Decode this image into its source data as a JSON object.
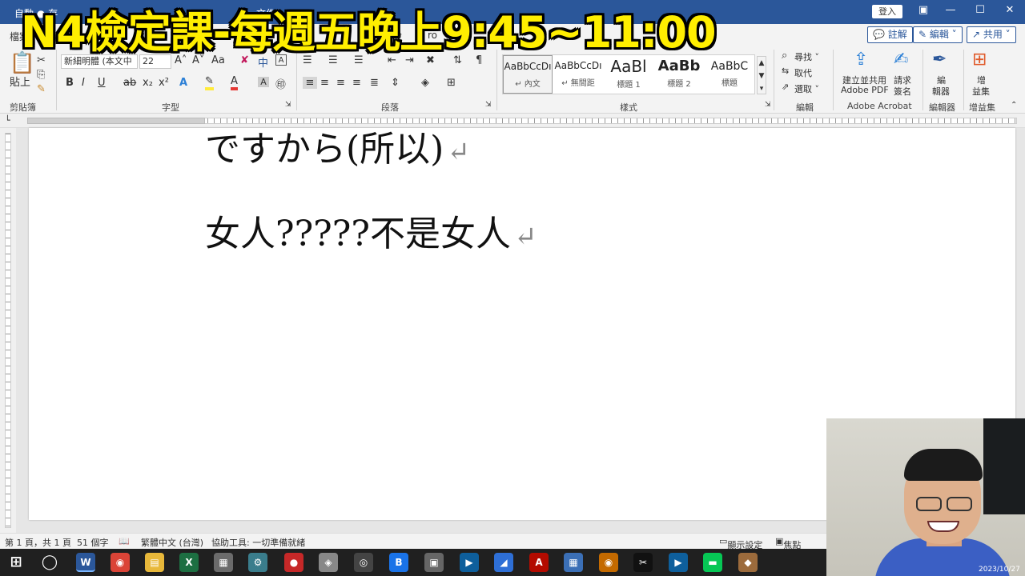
{
  "titlebar": {
    "left_text": "自動 ● 存",
    "doc_name": "文件1 -",
    "login": "登入",
    "controls": [
      "▣",
      "—",
      "☐",
      "✕"
    ]
  },
  "tabs": {
    "visible": [
      "檔案",
      "說",
      "ro"
    ],
    "right_buttons": {
      "comment": "💬 註解",
      "edit": "✎ 編輯 ˅",
      "share": "↗ 共用 ˅"
    }
  },
  "ribbon": {
    "clipboard": {
      "paste": "貼上",
      "label": "剪貼簿"
    },
    "font": {
      "family": "新細明體 (本文中",
      "size": "22",
      "label": "字型",
      "buttons": [
        "B",
        "I",
        "U",
        "ab",
        "x₂",
        "x²",
        "A",
        "A",
        "A",
        "㊞",
        "A˄",
        "A˅",
        "Aa",
        "中",
        "A"
      ]
    },
    "paragraph": {
      "label": "段落"
    },
    "styles": {
      "label": "樣式",
      "items": [
        {
          "preview": "AaBbCcDı",
          "name": "↵ 內文"
        },
        {
          "preview": "AaBbCcDı",
          "name": "↵ 無間距"
        },
        {
          "preview": "AaBl",
          "name": "標題 1"
        },
        {
          "preview": "AaBb",
          "name": "標題 2"
        },
        {
          "preview": "AaBbC",
          "name": "標題"
        }
      ]
    },
    "editing": {
      "label": "編輯",
      "find": "尋找 ˅",
      "replace": "取代",
      "select": "選取 ˅"
    },
    "acrobat": {
      "label": "Adobe Acrobat",
      "create": "建立並共用",
      "create2": "Adobe PDF",
      "sign": "請求",
      "sign2": "簽名"
    },
    "editor": {
      "label": "編輯器",
      "btn1": "編",
      "btn2": "輯器"
    },
    "addins": {
      "label": "增益集",
      "btn1": "增",
      "btn2": "益集"
    }
  },
  "document": {
    "line1": "ですから(所以)",
    "line2": "女人?????不是女人"
  },
  "statusbar": {
    "page": "第 1 頁，共 1 頁",
    "words": "51 個字",
    "lang": "繁體中文 (台灣)",
    "accessibility": "協助工具: 一切準備就緒",
    "display": "顯示設定",
    "focus": "焦點"
  },
  "overlay": {
    "title": "N4檢定課-每週五晚上9:45~11:00"
  },
  "webcam": {
    "timestamp": "2023/10/27"
  },
  "taskbar": {
    "apps": [
      {
        "name": "start",
        "glyph": "⊞",
        "color": "transparent"
      },
      {
        "name": "search",
        "glyph": "◯",
        "color": "transparent"
      },
      {
        "name": "word",
        "glyph": "W",
        "color": "#2b579a"
      },
      {
        "name": "chrome",
        "glyph": "◉",
        "color": "#db4437"
      },
      {
        "name": "explorer",
        "glyph": "▤",
        "color": "#e8b83a"
      },
      {
        "name": "excel",
        "glyph": "X",
        "color": "#1d6f42"
      },
      {
        "name": "notes",
        "glyph": "▦",
        "color": "#6b6b6b"
      },
      {
        "name": "app7",
        "glyph": "⚙",
        "color": "#3a7d8c"
      },
      {
        "name": "record",
        "glyph": "●",
        "color": "#c62828"
      },
      {
        "name": "app9",
        "glyph": "◈",
        "color": "#888"
      },
      {
        "name": "obs",
        "glyph": "◎",
        "color": "#444"
      },
      {
        "name": "app11",
        "glyph": "B",
        "color": "#1a73e8"
      },
      {
        "name": "app12",
        "glyph": "▣",
        "color": "#666"
      },
      {
        "name": "app13",
        "glyph": "▶",
        "color": "#0e5f9c"
      },
      {
        "name": "app14",
        "glyph": "◢",
        "color": "#2e6fd6"
      },
      {
        "name": "pdf",
        "glyph": "A",
        "color": "#b30b00"
      },
      {
        "name": "calc",
        "glyph": "▦",
        "color": "#3b6fb6"
      },
      {
        "name": "app17",
        "glyph": "◉",
        "color": "#c46a00"
      },
      {
        "name": "capcut",
        "glyph": "✂",
        "color": "#111"
      },
      {
        "name": "app19",
        "glyph": "▶",
        "color": "#0e5f9c"
      },
      {
        "name": "line",
        "glyph": "▬",
        "color": "#06c755"
      },
      {
        "name": "app21",
        "glyph": "◆",
        "color": "#9c6b3c"
      }
    ]
  }
}
